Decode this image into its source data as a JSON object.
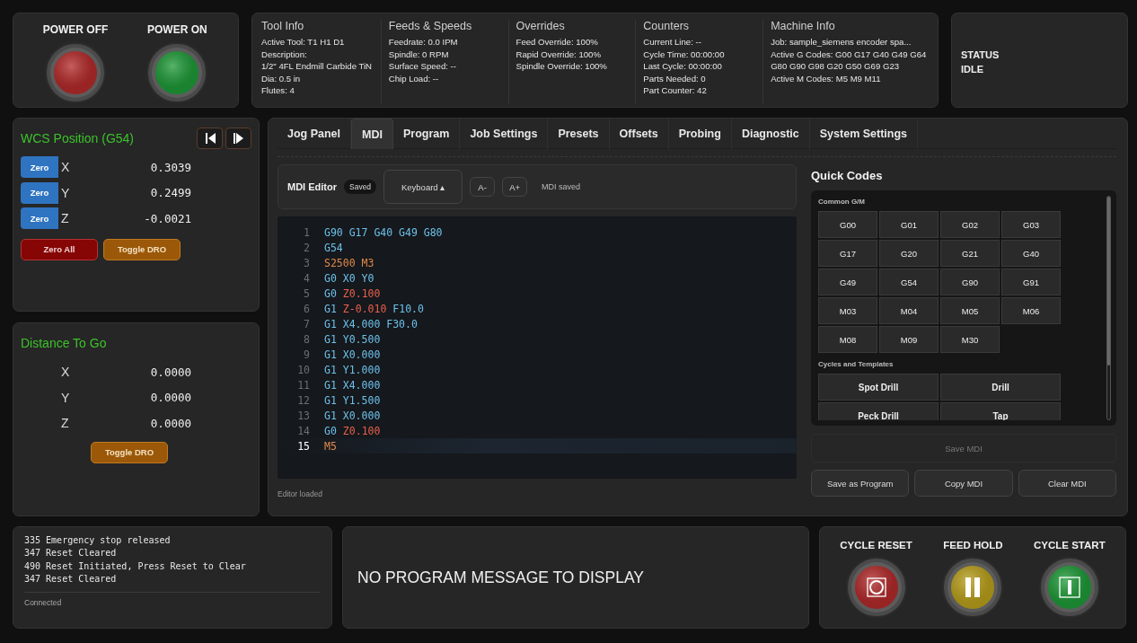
{
  "power": [
    {
      "label": "POWER OFF",
      "kind": "off"
    },
    {
      "label": "POWER ON",
      "kind": "on"
    }
  ],
  "info": [
    {
      "title": "Tool Info",
      "lines": [
        "Active Tool: T1 H1 D1",
        "Description:",
        "1/2\" 4FL Endmill Carbide TiN",
        "Dia: 0.5 in",
        "Flutes: 4"
      ]
    },
    {
      "title": "Feeds & Speeds",
      "lines": [
        "Feedrate: 0.0 IPM",
        "Spindle: 0 RPM",
        "Surface Speed: --",
        "Chip Load: --"
      ]
    },
    {
      "title": "Overrides",
      "lines": [
        "Feed Override: 100%",
        "Rapid Override: 100%",
        "Spindle Override: 100%"
      ]
    },
    {
      "title": "Counters",
      "lines": [
        "Current Line: --",
        "Cycle Time: 00:00:00",
        "Last Cycle: 00:00:00",
        "Parts Needed: 0",
        "Part Counter: 42"
      ]
    },
    {
      "title": "Machine Info",
      "lines": [
        "Job: sample_siemens encoder spa...",
        "Active G Codes: G00 G17 G40 G49 G64 G80 G90 G98 G20 G50 G69 G23",
        "Active M Codes: M5 M9 M11"
      ]
    }
  ],
  "status": {
    "label": "STATUS",
    "value": "IDLE"
  },
  "wcs": {
    "title": "WCS Position (G54)",
    "axes": [
      {
        "button": "Zero",
        "axis": "X",
        "value": "0.3039"
      },
      {
        "button": "Zero",
        "axis": "Y",
        "value": "0.2499"
      },
      {
        "button": "Zero",
        "axis": "Z",
        "value": "-0.0021"
      }
    ],
    "buttons": [
      {
        "label": "Zero All",
        "kind": "danger"
      },
      {
        "label": "Toggle DRO",
        "kind": "warn"
      }
    ]
  },
  "distance_to_go": {
    "title": "Distance To Go",
    "axes": [
      {
        "axis": "X",
        "value": "0.0000"
      },
      {
        "axis": "Y",
        "value": "0.0000"
      },
      {
        "axis": "Z",
        "value": "0.0000"
      }
    ],
    "buttons": [
      {
        "label": "Toggle DRO",
        "kind": "warn"
      }
    ]
  },
  "tabs": [
    {
      "label": "Jog Panel",
      "selected": false
    },
    {
      "label": "MDI",
      "selected": true
    },
    {
      "label": "Program",
      "selected": false
    },
    {
      "label": "Job Settings",
      "selected": false
    },
    {
      "label": "Presets",
      "selected": false
    },
    {
      "label": "Offsets",
      "selected": false
    },
    {
      "label": "Probing",
      "selected": false
    },
    {
      "label": "Diagnostic",
      "selected": false
    },
    {
      "label": "System Settings",
      "selected": false
    }
  ],
  "mdi": {
    "title": "MDI Editor",
    "badge": "Saved",
    "keyboard": "Keyboard ▴",
    "font_buttons": [
      "A-",
      "A+"
    ],
    "message": "MDI saved",
    "lines": [
      {
        "number": "1",
        "selected": false,
        "tokens": [
          {
            "text": "G90 G17 G40 G49 G80",
            "kind": "code"
          }
        ]
      },
      {
        "number": "2",
        "selected": false,
        "tokens": [
          {
            "text": "G54",
            "kind": "code"
          }
        ]
      },
      {
        "number": "3",
        "selected": false,
        "tokens": [
          {
            "text": "S2500 M3",
            "kind": "spindle"
          }
        ]
      },
      {
        "number": "4",
        "selected": false,
        "tokens": [
          {
            "text": "G0 X0 Y0",
            "kind": "code"
          }
        ]
      },
      {
        "number": "5",
        "selected": false,
        "tokens": [
          {
            "text": "G0",
            "kind": "code"
          },
          {
            "text": "Z0.100",
            "kind": "depth"
          }
        ]
      },
      {
        "number": "6",
        "selected": false,
        "tokens": [
          {
            "text": "G1",
            "kind": "code"
          },
          {
            "text": "Z-0.010",
            "kind": "depth"
          },
          {
            "text": "F10.0",
            "kind": "code"
          }
        ]
      },
      {
        "number": "7",
        "selected": false,
        "tokens": [
          {
            "text": "G1 X4.000 F30.0",
            "kind": "code"
          }
        ]
      },
      {
        "number": "8",
        "selected": false,
        "tokens": [
          {
            "text": "G1 Y0.500",
            "kind": "code"
          }
        ]
      },
      {
        "number": "9",
        "selected": false,
        "tokens": [
          {
            "text": "G1 X0.000",
            "kind": "code"
          }
        ]
      },
      {
        "number": "10",
        "selected": false,
        "tokens": [
          {
            "text": "G1 Y1.000",
            "kind": "code"
          }
        ]
      },
      {
        "number": "11",
        "selected": false,
        "tokens": [
          {
            "text": "G1 X4.000",
            "kind": "code"
          }
        ]
      },
      {
        "number": "12",
        "selected": false,
        "tokens": [
          {
            "text": "G1 Y1.500",
            "kind": "code"
          }
        ]
      },
      {
        "number": "13",
        "selected": false,
        "tokens": [
          {
            "text": "G1 X0.000",
            "kind": "code"
          }
        ]
      },
      {
        "number": "14",
        "selected": false,
        "tokens": [
          {
            "text": "G0",
            "kind": "code"
          },
          {
            "text": "Z0.100",
            "kind": "depth"
          }
        ]
      },
      {
        "number": "15",
        "selected": true,
        "tokens": [
          {
            "text": "M5",
            "kind": "spindle"
          }
        ]
      }
    ],
    "footer": "Editor loaded"
  },
  "quick_codes": {
    "title": "Quick Codes",
    "sections": [
      {
        "title": "Common G/M",
        "kind": "codes",
        "items": [
          "G00",
          "G01",
          "G02",
          "G03",
          "G17",
          "G20",
          "G21",
          "G40",
          "G49",
          "G54",
          "G90",
          "G91",
          "M03",
          "M04",
          "M05",
          "M06",
          "M08",
          "M09",
          "M30"
        ]
      },
      {
        "title": "Cycles and Templates",
        "kind": "templates",
        "items": [
          "Spot Drill",
          "Drill",
          "Peck Drill",
          "Tap"
        ]
      }
    ],
    "save": {
      "label": "Save MDI",
      "disabled": true
    },
    "actions": [
      "Save as Program",
      "Copy MDI",
      "Clear MDI"
    ]
  },
  "log": {
    "lines": [
      "335 Emergency stop released",
      "347 Reset Cleared",
      "490 Reset Initiated, Press Reset to Clear",
      "347 Reset Cleared"
    ],
    "status": "Connected"
  },
  "program_message": "NO PROGRAM MESSAGE TO DISPLAY",
  "cycle": [
    {
      "label": "CYCLE RESET",
      "kind": "reset"
    },
    {
      "label": "FEED HOLD",
      "kind": "hold"
    },
    {
      "label": "CYCLE START",
      "kind": "start"
    }
  ]
}
